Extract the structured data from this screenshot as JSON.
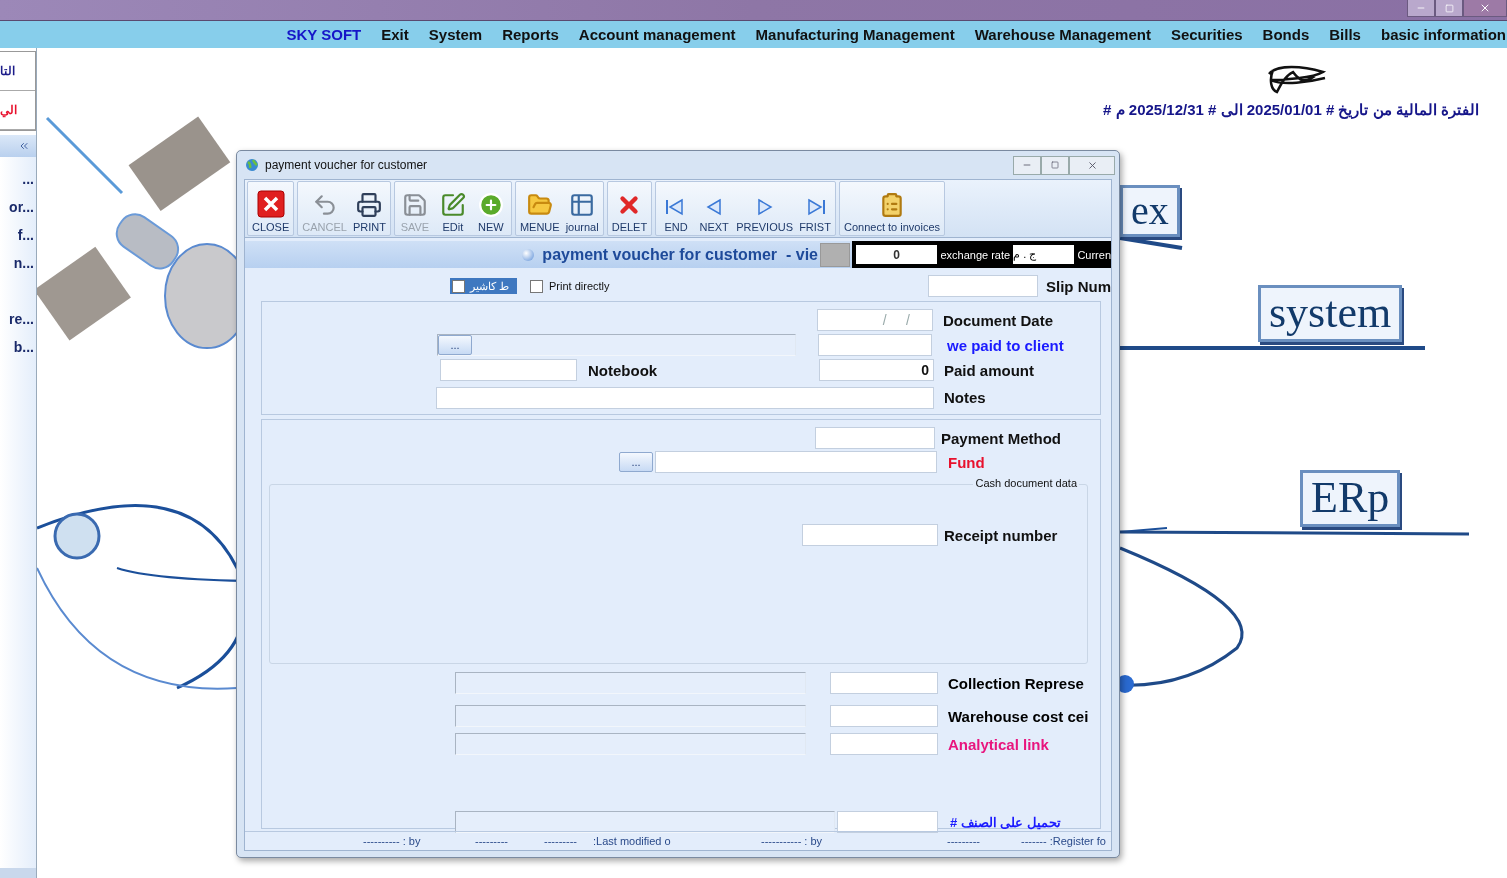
{
  "menu": {
    "brand": "SKY SOFT",
    "items": [
      "Exit",
      "System",
      "Reports",
      "Account management",
      "Manufacturing Management",
      "Warehouse Management",
      "Securities",
      "Bonds",
      "Bills",
      "basic information"
    ]
  },
  "sidebar": {
    "tabs": [
      {
        "label": "التا",
        "color": "#1c1c8a"
      },
      {
        "label": "الي",
        "color": "#e8112d"
      }
    ],
    "items": [
      "...",
      "or...",
      "f...",
      "n..."
    ],
    "lower_items": [
      "re...",
      "b..."
    ]
  },
  "period": "الفترة المالية من تاريخ  # 2025/01/01 الى #  2025/12/31 م #",
  "backdrop_labels": [
    "ex",
    "system",
    "ERp"
  ],
  "dialog": {
    "title": "payment voucher for customer",
    "toolbar": [
      {
        "buttons": [
          {
            "label": "CLOSE",
            "disabled": false
          }
        ]
      },
      {
        "buttons": [
          {
            "label": "CANCEL",
            "disabled": true
          },
          {
            "label": "PRINT",
            "disabled": false
          }
        ]
      },
      {
        "buttons": [
          {
            "label": "SAVE",
            "disabled": true
          },
          {
            "label": "EDit",
            "disabled": false
          },
          {
            "label": "NEW",
            "disabled": false
          }
        ]
      },
      {
        "buttons": [
          {
            "label": "MENUE",
            "disabled": false
          },
          {
            "label": "journal",
            "disabled": false
          }
        ]
      },
      {
        "buttons": [
          {
            "label": "DELET",
            "disabled": false
          }
        ]
      },
      {
        "buttons": [
          {
            "label": "END",
            "disabled": false
          },
          {
            "label": "NEXT",
            "disabled": false
          },
          {
            "label": "PREVIOUS",
            "disabled": false
          },
          {
            "label": "FRIST",
            "disabled": false
          }
        ]
      },
      {
        "buttons": [
          {
            "label": "Connect to invoices",
            "disabled": false
          }
        ]
      }
    ],
    "banner": {
      "title": "payment voucher for customer  - vie",
      "rate_value": "0",
      "rate_label": "exchange rate",
      "currency": "ج . م",
      "currency_label": "Curren"
    },
    "options": [
      {
        "label": "ط كاشير",
        "checked": false,
        "kind": "tag"
      },
      {
        "label": "Print directly",
        "checked": false,
        "kind": "plain"
      }
    ],
    "slip_label": "Slip Num",
    "main_fields": {
      "document_date": {
        "label": "Document Date",
        "mask": "/     /"
      },
      "client": {
        "label": "we paid to client",
        "color": "#1a1aff",
        "browse": "..."
      },
      "notebook": {
        "label": "Notebook"
      },
      "paid_amount": {
        "label": "Paid amount",
        "value": "0"
      },
      "notes": {
        "label": "Notes"
      }
    },
    "payment": {
      "method_label": "Payment Method",
      "fund": {
        "label": "Fund",
        "color": "#e8112d",
        "browse": "..."
      },
      "cash_legend": "Cash document data",
      "receipt_label": "Receipt number",
      "links": [
        {
          "label": "Collection Represe",
          "color": "#000000"
        },
        {
          "label": "Warehouse cost cei",
          "color": "#000000"
        },
        {
          "label": "Analytical link",
          "color": "#e8157e"
        }
      ],
      "load_label": "تحميل على الصنف #"
    },
    "footer": [
      "---------- : by",
      "---------",
      "---------",
      ":Last modified o",
      "----------- : by",
      "---------",
      "------- :Register fo"
    ]
  }
}
